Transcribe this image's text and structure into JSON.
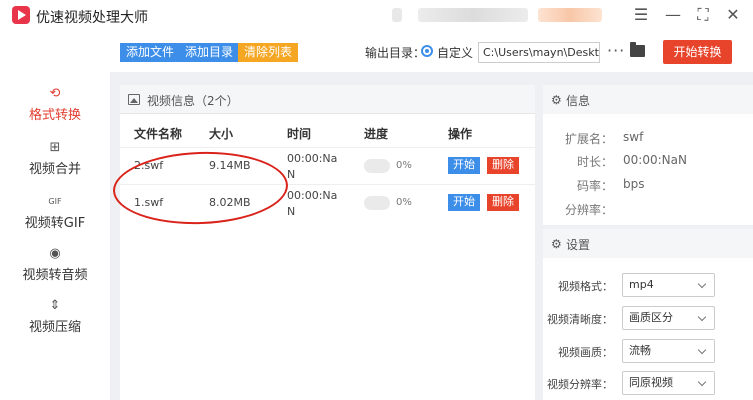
{
  "window": {
    "title": "优速视频处理大师",
    "controls": [
      "menu-icon",
      "minimize-icon",
      "fullscreen-icon",
      "close-icon"
    ]
  },
  "sidebar": {
    "items": [
      {
        "label": "格式转换",
        "icon": "convert-icon",
        "active": true
      },
      {
        "label": "视频合并",
        "icon": "merge-icon",
        "active": false
      },
      {
        "label": "视频转GIF",
        "icon": "gif-icon",
        "active": false
      },
      {
        "label": "视频转音频",
        "icon": "audio-icon",
        "active": false
      },
      {
        "label": "视频压缩",
        "icon": "compress-icon",
        "active": false
      }
    ]
  },
  "toolbar": {
    "add_file": "添加文件",
    "add_dir": "添加目录",
    "clear_list": "清除列表",
    "output_label": "输出目录：",
    "custom_label": "自定义",
    "output_path": "C:\\Users\\mayn\\Desktop",
    "start_convert": "开始转换"
  },
  "video_panel": {
    "title": "视频信息（2个）",
    "columns": [
      "文件名称",
      "大小",
      "时间",
      "进度",
      "操作"
    ],
    "rows": [
      {
        "name": "2.swf",
        "size": "9.14MB",
        "time_line1": "00:00:Na",
        "time_line2": "N",
        "progress": "0%",
        "start": "开始",
        "delete": "删除"
      },
      {
        "name": "1.swf",
        "size": "8.02MB",
        "time_line1": "00:00:Na",
        "time_line2": "N",
        "progress": "0%",
        "start": "开始",
        "delete": "删除"
      }
    ]
  },
  "info_panel": {
    "title": "信息",
    "fields": [
      {
        "label": "扩展名：",
        "value": "swf"
      },
      {
        "label": "时长：",
        "value": "00:00:NaN"
      },
      {
        "label": "码率：",
        "value": "bps"
      },
      {
        "label": "分辨率：",
        "value": ""
      }
    ]
  },
  "settings_panel": {
    "title": "设置",
    "fields": [
      {
        "label": "视频格式：",
        "value": "mp4"
      },
      {
        "label": "视频清晰度：",
        "value": "画质区分"
      },
      {
        "label": "视频画质：",
        "value": "流畅"
      },
      {
        "label": "视频分辨率：",
        "value": "同原视频"
      }
    ]
  },
  "colors": {
    "accent_blue": "#3d8ee9",
    "accent_red": "#e8442c",
    "accent_orange": "#f5a623",
    "active_nav": "#e23c2e"
  }
}
